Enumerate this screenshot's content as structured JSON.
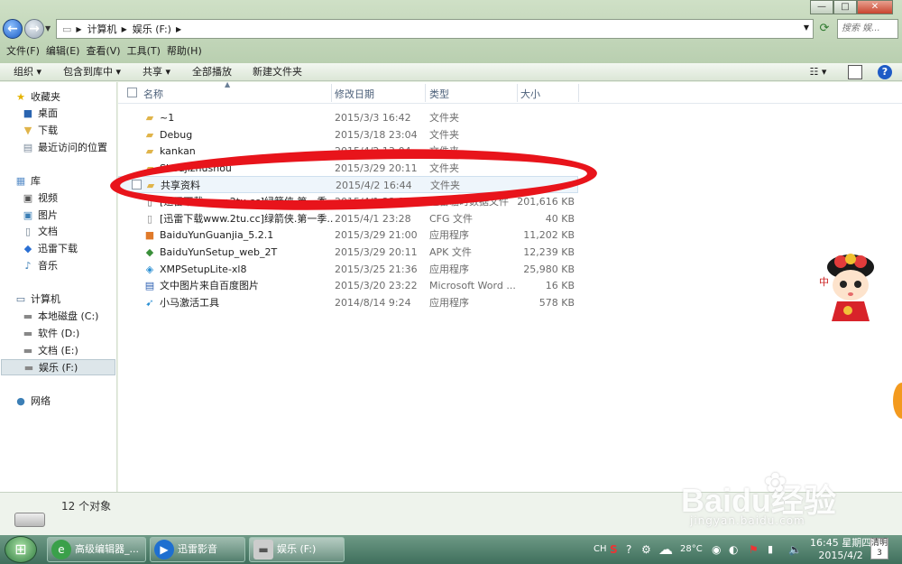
{
  "window": {
    "minimize": "—",
    "maximize": "□",
    "close": "✕"
  },
  "address": {
    "root": "计算机",
    "current": "娱乐 (F:)"
  },
  "search": {
    "placeholder": "搜索 娱..."
  },
  "menu": [
    "文件(F)",
    "编辑(E)",
    "查看(V)",
    "工具(T)",
    "帮助(H)"
  ],
  "toolbar": {
    "organize": "组织 ▾",
    "include": "包含到库中 ▾",
    "share": "共享 ▾",
    "playall": "全部播放",
    "newfolder": "新建文件夹"
  },
  "nav": {
    "favorites": "收藏夹",
    "desktop": "桌面",
    "downloads": "下载",
    "recent": "最近访问的位置",
    "libraries": "库",
    "videos": "视频",
    "pictures": "图片",
    "documents": "文档",
    "xunlei": "迅雷下载",
    "music": "音乐",
    "computer": "计算机",
    "c": "本地磁盘 (C:)",
    "d": "软件 (D:)",
    "e": "文档 (E:)",
    "f": "娱乐 (F:)",
    "network": "网络"
  },
  "columns": {
    "name": "名称",
    "date": "修改日期",
    "type": "类型",
    "size": "大小"
  },
  "files": [
    {
      "name": "~1",
      "date": "2015/3/3 16:42",
      "type": "文件夹",
      "size": "",
      "icon": "folder"
    },
    {
      "name": "Debug",
      "date": "2015/3/18 23:04",
      "type": "文件夹",
      "size": "",
      "icon": "folder"
    },
    {
      "name": "kankan",
      "date": "2015/4/2 13:04",
      "type": "文件夹",
      "size": "",
      "icon": "folder"
    },
    {
      "name": "Shoujizhushou",
      "date": "2015/3/29 20:11",
      "type": "文件夹",
      "size": "",
      "icon": "folder"
    },
    {
      "name": "共享资料",
      "date": "2015/4/2 16:44",
      "type": "文件夹",
      "size": "",
      "icon": "folder"
    },
    {
      "name": "[迅雷下载www.2tu.cc]绿箭侠.第一季...",
      "date": "2015/4/1 23:28",
      "type": "迅雷临时数据文件",
      "size": "201,616 KB",
      "icon": "file"
    },
    {
      "name": "[迅雷下载www.2tu.cc]绿箭侠.第一季...",
      "date": "2015/4/1 23:28",
      "type": "CFG 文件",
      "size": "40 KB",
      "icon": "file"
    },
    {
      "name": "BaiduYunGuanjia_5.2.1",
      "date": "2015/3/29 21:00",
      "type": "应用程序",
      "size": "11,202 KB",
      "icon": "app"
    },
    {
      "name": "BaiduYunSetup_web_2T",
      "date": "2015/3/29 20:11",
      "type": "APK 文件",
      "size": "12,239 KB",
      "icon": "apk"
    },
    {
      "name": "XMPSetupLite-xl8",
      "date": "2015/3/25 21:36",
      "type": "应用程序",
      "size": "25,980 KB",
      "icon": "setup"
    },
    {
      "name": "文中图片来自百度图片",
      "date": "2015/3/20 23:22",
      "type": "Microsoft Word ...",
      "size": "16 KB",
      "icon": "word"
    },
    {
      "name": "小马激活工具",
      "date": "2014/8/14 9:24",
      "type": "应用程序",
      "size": "578 KB",
      "icon": "tool"
    }
  ],
  "status": {
    "count": "12 个对象"
  },
  "watermark": {
    "brand": "Baidu经验",
    "url": "jingyan.baidu.com"
  },
  "mascot": {
    "text": "中"
  },
  "taskbar": {
    "btn1": "高级编辑器_...",
    "btn2": "迅雷影音",
    "btn3": "娱乐 (F:)",
    "lang": "CH",
    "temp": "28°C",
    "time": "16:45 星期四",
    "date": "2015/4/2",
    "weather": "清明",
    "weather_num": "3"
  }
}
